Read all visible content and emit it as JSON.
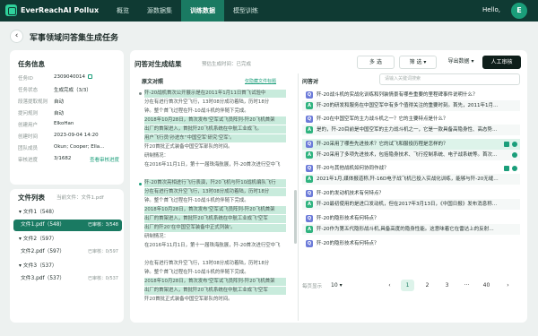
{
  "app": {
    "name": "EverReachAI Pollux",
    "hello": "Hello,",
    "avatar_letter": "E"
  },
  "nav": [
    "概览",
    "源数据集",
    "训练数据",
    "模型训练"
  ],
  "page_title": "军事领域问答集生成任务",
  "task_info": {
    "title": "任务信息",
    "rows": [
      {
        "k": "任务ID",
        "v": "2309040014"
      },
      {
        "k": "任务状态",
        "v": "生成完成（3/3）"
      },
      {
        "k": "段落提取规则",
        "v": "自动"
      },
      {
        "k": "提问规则",
        "v": "自动"
      },
      {
        "k": "创建用户",
        "v": "ElkoHan"
      },
      {
        "k": "创建时间",
        "v": "2023-09-04 14:20"
      },
      {
        "k": "团队成员",
        "v": "Okun; Cooper; Ella…"
      },
      {
        "k": "审核进度",
        "v": "3/1682"
      }
    ],
    "review_link": "查看审核进度"
  },
  "file_list": {
    "title": "文件列表",
    "current_label": "当前文件：文件1.pdf",
    "items": [
      {
        "name": "文件1（548）",
        "status": "",
        "count": ""
      },
      {
        "name": "文件1.pdf（548）",
        "status": "已审核：",
        "count": "3/548"
      },
      {
        "name": "文件2（597）",
        "status": "",
        "count": ""
      },
      {
        "name": "文件2.pdf（597）",
        "status": "已审核：",
        "count": "0/597"
      },
      {
        "name": "文件3（537）",
        "status": "",
        "count": ""
      },
      {
        "name": "文件3.pdf（537）",
        "status": "已审核：",
        "count": "0/537"
      }
    ]
  },
  "results": {
    "title": "问答对生成结果",
    "subtitle": "预估生成时间：已完成",
    "btn_multi": "多 选",
    "btn_filter": "筛 选",
    "btn_export": "导出数据",
    "btn_review": "人工审核",
    "original_label": "原文对照",
    "hide_tip": "仅隐藏文件标题",
    "qa_label": "问答对",
    "search_placeholder": "请输入关键词搜索"
  },
  "doc_lines": [
    "歼-20战机首次公开展示是在2011年1月11日首飞试验中",
    "分在有进行首次升空飞行，13时08分成功着陆，历时18分",
    "钟。整个首飞过程在歼-10战斗机的伴随下完成。",
    "2018年10月28日，首次发布'空军试飞员阵列-歼20飞机首架",
    "出厂的首架进入，首批歼20飞机系统在中航工业成飞。",
    "用户飞行员'孙进东''中国空军'研究'空军'。",
    "歼20首批正式装备中国空军部队的时间。",
    "研制情况：",
    "在2016年11月1日，第十一届珠海航展，歼-20首次进行空中飞",
    "歼-20首次亮相进行飞行表演，歼20飞机与歼10战机编队飞行",
    "分在有进行首次升空飞行，13时08分成功着陆，历时18分",
    "钟。整个首飞过程在歼-10战斗机的伴随下完成。",
    "2018年10月28日，首次发布'空军试飞员阵列-歼20飞机首架",
    "出厂的首架进入，首批歼20飞机系统在中航工业成飞'空军",
    "出厂的歼20'在中国空军装备中正式列装'。",
    "研制情况：",
    "在2016年11月1日，第十一届珠海航展，歼-20首次进行空中飞",
    "分在有进行首次升空飞行，13时08分成功着陆，历时18分",
    "钟。整个首飞过程在歼-10战斗机的伴随下完成。",
    "2018年10月28日，首次发布'空军试飞员阵列-歼20飞机首架",
    "出厂的首架进入，首批歼20飞机系统在中航工业成飞'空军",
    "歼20首批正式装备中国空军部队的时间。"
  ],
  "qa": [
    {
      "t": "Q",
      "text": "歼-20战斗机的实战化训练和列装情景有哪些重要的里程碑事件说明什么？"
    },
    {
      "t": "A",
      "text": "歼-20的研发和服务在中国空军中有多个值得关注的重要时刻。首先，2011年1月11日，歼-20实现了首飞。"
    },
    {
      "t": "Q",
      "text": "歼-20在中国空军的主力战斗机之一？它的主要特点是什么？"
    },
    {
      "t": "A",
      "text": "是的，歼-20目前是中国空军的主力战斗机之一，它是一款具备高隐身性、高态势感知、高机动性的战机。"
    },
    {
      "t": "Q",
      "text": "歼-20采用了哪些先进技术？它的试飞和服役历程是怎样的？"
    },
    {
      "t": "A",
      "text": "歼-20采用了多项先进技术，包括隐身技术、飞行控制系统、电子战系统等。首次完成了歼-20的飞行试验。"
    },
    {
      "t": "Q",
      "text": "歼-20与其他战机如何协同作战？"
    },
    {
      "t": "A",
      "text": "2021年1月,媒体报道称,歼-16D电子战飞机已投入实战化训练，能够与歼-20无缝链接。"
    },
    {
      "t": "Q",
      "text": "歼-20的发动机技术有何特点？"
    },
    {
      "t": "A",
      "text": "歼-20最初使用的是进口发动机，但在2017年3月13日，《中国日报》发布消息称我国国产发动机已装备。"
    },
    {
      "t": "Q",
      "text": "歼-20的隐形技术有何特点？"
    },
    {
      "t": "A",
      "text": "歼-20作为第五代隐形战斗机,具备高度的隐身性能。这意味着它在雷达上的反射面积极小。"
    },
    {
      "t": "Q",
      "text": "歼-20的隐形技术有何特点？"
    }
  ],
  "pager": {
    "per_page_label": "每页显示",
    "per_page": "10",
    "pages": [
      "1",
      "2",
      "3",
      "···",
      "40"
    ]
  }
}
